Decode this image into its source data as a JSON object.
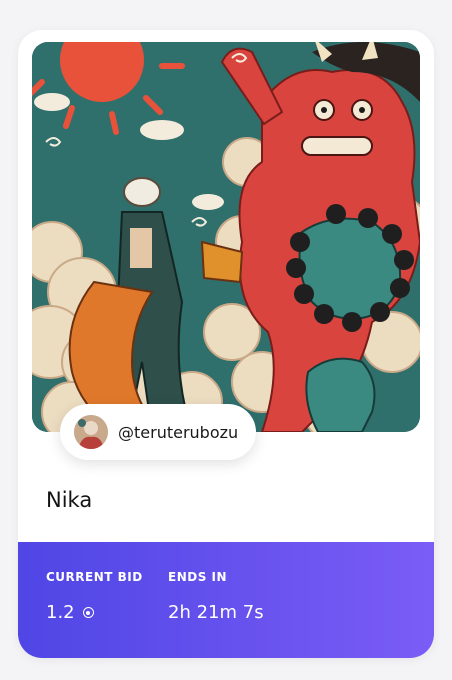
{
  "artwork": {
    "name": "Nika",
    "image_icon": "artwork-image"
  },
  "creator": {
    "handle": "@teruterubozu",
    "avatar_icon": "creator-avatar"
  },
  "auction": {
    "current_bid_label": "CURRENT BID",
    "current_bid_value": "1.2",
    "currency_icon": "eth-coin-icon",
    "ends_in_label": "ENDS IN",
    "ends_in_value": "2h 21m 7s"
  },
  "colors": {
    "gradient_start": "#4f46e5",
    "gradient_end": "#7b5cf6",
    "card_background": "#ffffff",
    "page_background": "#f4f4f6"
  }
}
